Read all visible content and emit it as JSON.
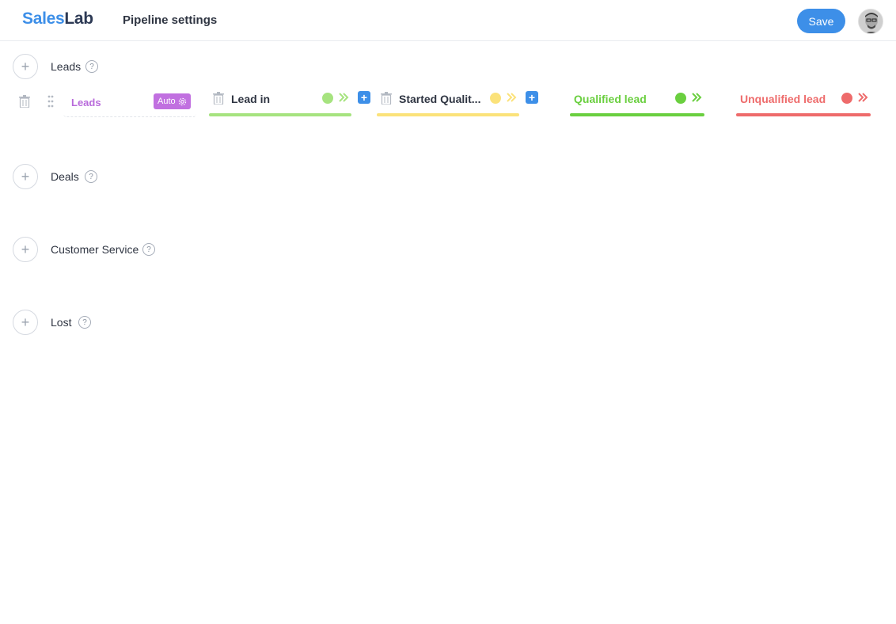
{
  "app": {
    "logo_part1": "Sales",
    "logo_part2": "Lab",
    "page_title": "Pipeline settings"
  },
  "header": {
    "save_label": "Save"
  },
  "sections": [
    {
      "label": "Leads"
    },
    {
      "label": "Deals"
    },
    {
      "label": "Customer Service"
    },
    {
      "label": "Lost"
    }
  ],
  "pipeline": {
    "name": "Leads",
    "auto_label": "Auto",
    "stages": [
      {
        "name": "Lead in",
        "color": "#a6e37f"
      },
      {
        "name": "Started Qualit...",
        "color": "#fbe27a"
      },
      {
        "name": "Qualified lead",
        "color": "#6acf3f"
      },
      {
        "name": "Unqualified lead",
        "color": "#ee6b6b"
      }
    ]
  },
  "colors": {
    "accent": "#3d8fe8",
    "pipeline_name": "#b86adb",
    "auto_badge": "#c170e0"
  }
}
